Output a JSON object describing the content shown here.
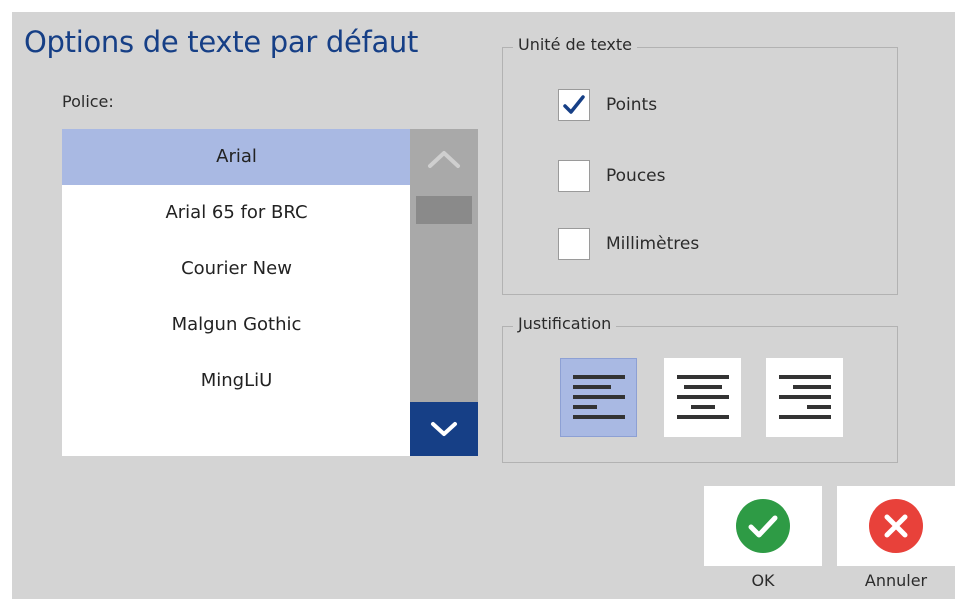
{
  "dialog": {
    "title": "Options de texte par défaut"
  },
  "font": {
    "label": "Police:",
    "items": [
      "Arial",
      "Arial 65 for BRC",
      "Courier New",
      "Malgun Gothic",
      "MingLiU"
    ],
    "selected": "Arial"
  },
  "scrollbar": {
    "up_icon": "chevron-up-icon",
    "down_icon": "chevron-down-icon"
  },
  "text_unit": {
    "legend": "Unité de texte",
    "options": [
      {
        "label": "Points",
        "checked": true
      },
      {
        "label": "Pouces",
        "checked": false
      },
      {
        "label": "Millimètres",
        "checked": false
      }
    ]
  },
  "justification": {
    "legend": "Justification",
    "options": [
      {
        "icon": "align-left-icon",
        "selected": true
      },
      {
        "icon": "align-center-icon",
        "selected": false
      },
      {
        "icon": "align-right-icon",
        "selected": false
      }
    ]
  },
  "actions": {
    "ok_label": "OK",
    "cancel_label": "Annuler"
  },
  "colors": {
    "title": "#163f86",
    "selection": "#a9b9e3",
    "ok_green": "#2e9b45",
    "cancel_red": "#e8413a",
    "scroll_down_bg": "#163f86"
  }
}
